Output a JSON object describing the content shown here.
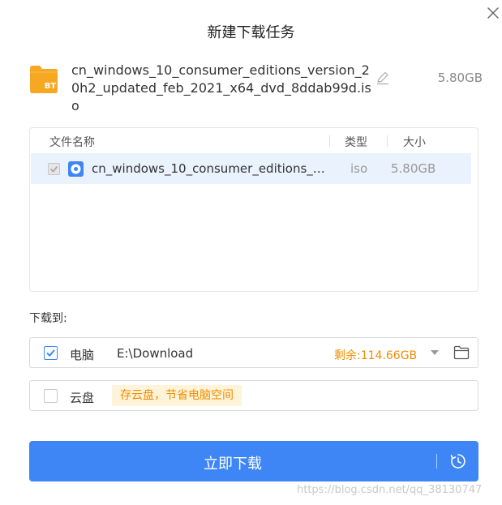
{
  "dialog": {
    "title": "新建下载任务"
  },
  "file": {
    "icon": "bt-torrent-file-icon",
    "icon_label": "BT",
    "name": "cn_windows_10_consumer_editions_version_20h2_updated_feb_2021_x64_dvd_8ddab99d.iso",
    "total_size": "5.80GB"
  },
  "table": {
    "columns": [
      "文件名称",
      "类型",
      "大小"
    ],
    "rows": [
      {
        "checked": true,
        "name": "cn_windows_10_consumer_editions_ve...",
        "type": "iso",
        "size": "5.80GB"
      }
    ]
  },
  "download_to": {
    "label": "下载到:",
    "pc": {
      "checked": true,
      "label": "电脑",
      "path": "E:\\Download",
      "free": "剩余:114.66GB"
    },
    "cloud": {
      "checked": false,
      "label": "云盘",
      "tip": "存云盘，节省电脑空间"
    }
  },
  "actions": {
    "download_now": "立即下载"
  },
  "watermark": "https://blog.csdn.net/qq_38130747",
  "colors": {
    "accent": "#3e86f6",
    "warning_text": "#f28c00",
    "tip_bg": "#fff4d9",
    "row_highlight": "#eaf2fd",
    "bt_folder": "#f7a823"
  }
}
